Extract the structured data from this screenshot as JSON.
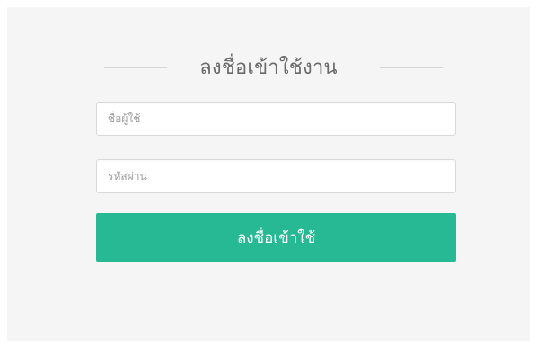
{
  "login": {
    "title": "ลงชื่อเข้าใช้งาน",
    "username_placeholder": "ชื่อผู้ใช้",
    "password_placeholder": "รหัสผ่าน",
    "submit_label": "ลงชื่อเข้าใช้"
  },
  "colors": {
    "page_background": "#ffffff",
    "card_background": "#f5f5f5",
    "accent_button": "#27b894",
    "title_text": "#6a6a6a",
    "divider": "#d6d6d6"
  }
}
